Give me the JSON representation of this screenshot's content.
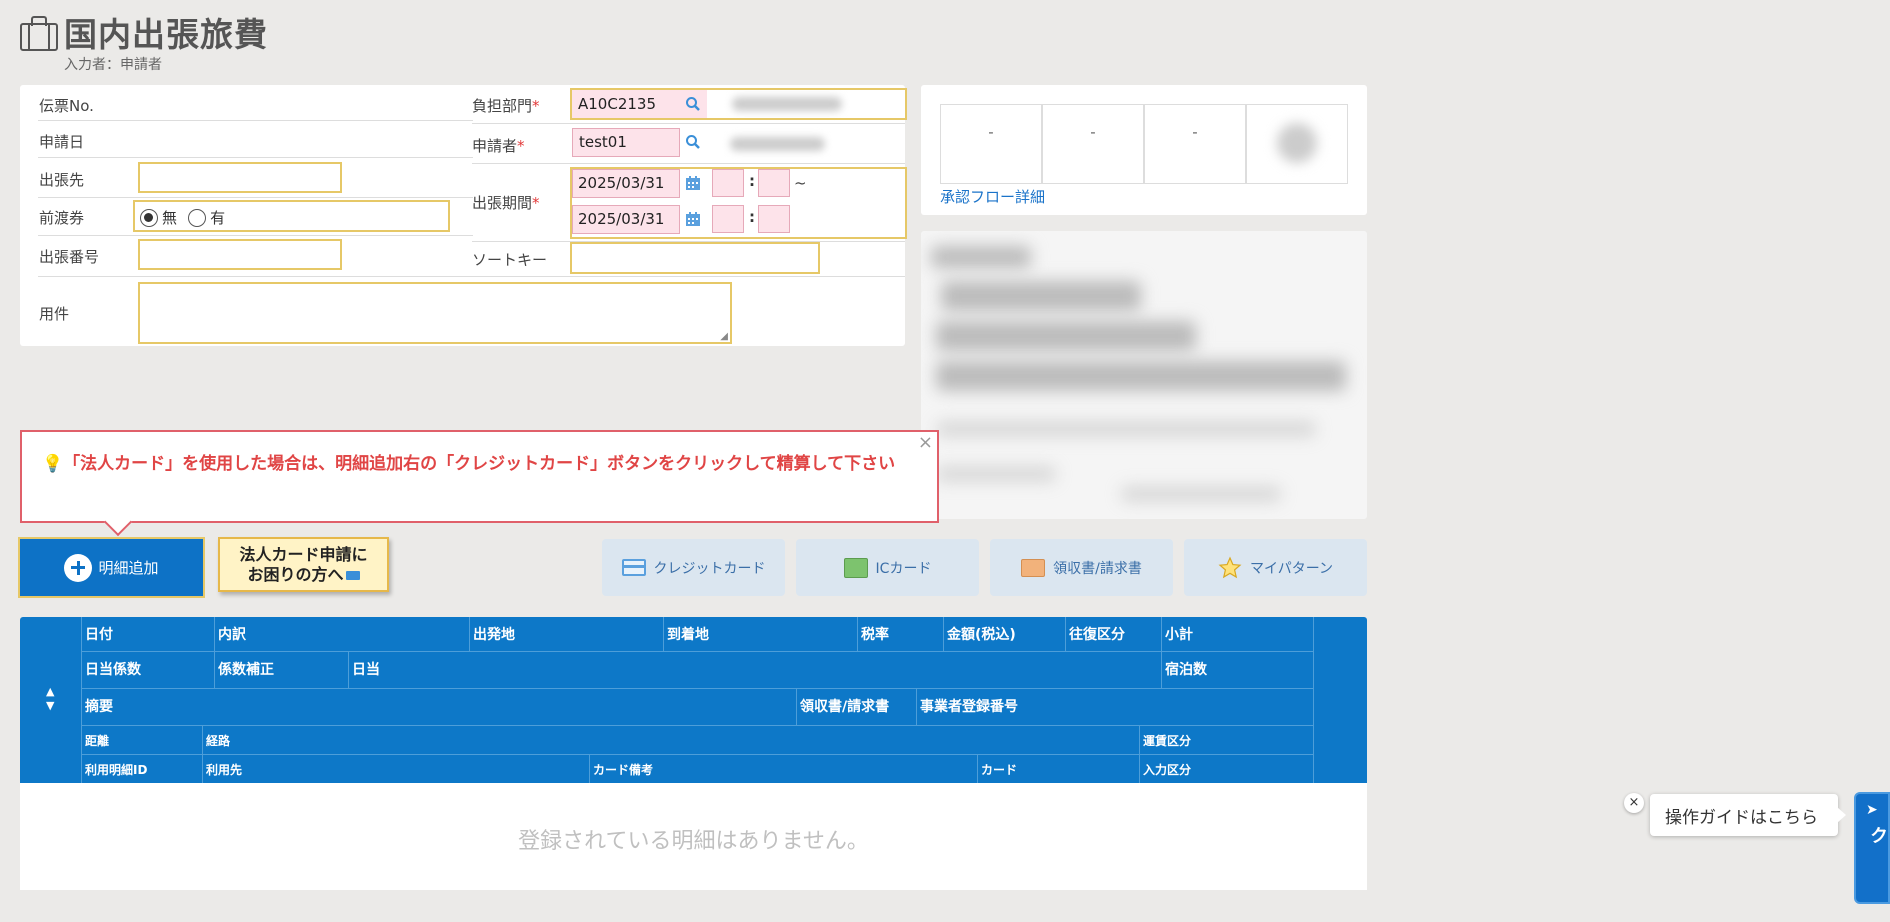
{
  "header": {
    "title": "国内出張旅費",
    "entrant": "入力者：申請者"
  },
  "form": {
    "slip_no_label": "伝票No.",
    "apply_date_label": "申請日",
    "destination_label": "出張先",
    "destination_value": "",
    "advance_ticket_label": "前渡券",
    "advance_option_no": "無",
    "advance_option_yes": "有",
    "advance_selected": "無",
    "trip_number_label": "出張番号",
    "trip_number_value": "",
    "purpose_label": "用件",
    "purpose_value": "",
    "dept_label": "負担部門",
    "dept_value": "A10C2135",
    "applicant_label": "申請者",
    "applicant_value": "test01",
    "period_label": "出張期間",
    "period_start": "2025/03/31",
    "period_end": "2025/03/31",
    "period_sep": "~",
    "time_colon": ":",
    "sort_key_label": "ソートキー",
    "sort_key_value": "",
    "required_mark": "*"
  },
  "approval": {
    "cells": [
      "-",
      "-",
      "-"
    ],
    "flow_link": "承認フロー詳細"
  },
  "notice": {
    "text": "「法人カード」を使用した場合は、明細追加右の「クレジットカード」ボタンをクリックして精算して下さい",
    "close": "×"
  },
  "buttons": {
    "add_detail": "明細追加",
    "corp_card_line1": "法人カード申請に",
    "corp_card_line2": "お困りの方へ",
    "credit_card": "クレジットカード",
    "ic_card": "ICカード",
    "receipt": "領収書/請求書",
    "my_pattern": "マイパターン"
  },
  "table": {
    "row1": [
      "日付",
      "内訳",
      "出発地",
      "到着地",
      "税率",
      "金額(税込)",
      "往復区分",
      "小計"
    ],
    "row2": [
      "日当係数",
      "係数補正",
      "日当",
      "宿泊数"
    ],
    "row3": [
      "摘要",
      "領収書/請求書",
      "事業者登録番号"
    ],
    "row4": [
      "距離",
      "経路",
      "運賃区分"
    ],
    "row5": [
      "利用明細ID",
      "利用先",
      "カード備考",
      "カード",
      "入力区分"
    ],
    "sort_up": "▲",
    "sort_down": "▼",
    "empty_message": "登録されている明細はありません。"
  },
  "guide": {
    "bubble": "操作ガイドはこちら",
    "close": "×",
    "tab": "クリック"
  },
  "colors": {
    "primary": "#0d78c8",
    "required": "#e23a3a",
    "notice": "#e04545",
    "field_border": "#e6c867",
    "field_pink": "#fde3ea"
  }
}
